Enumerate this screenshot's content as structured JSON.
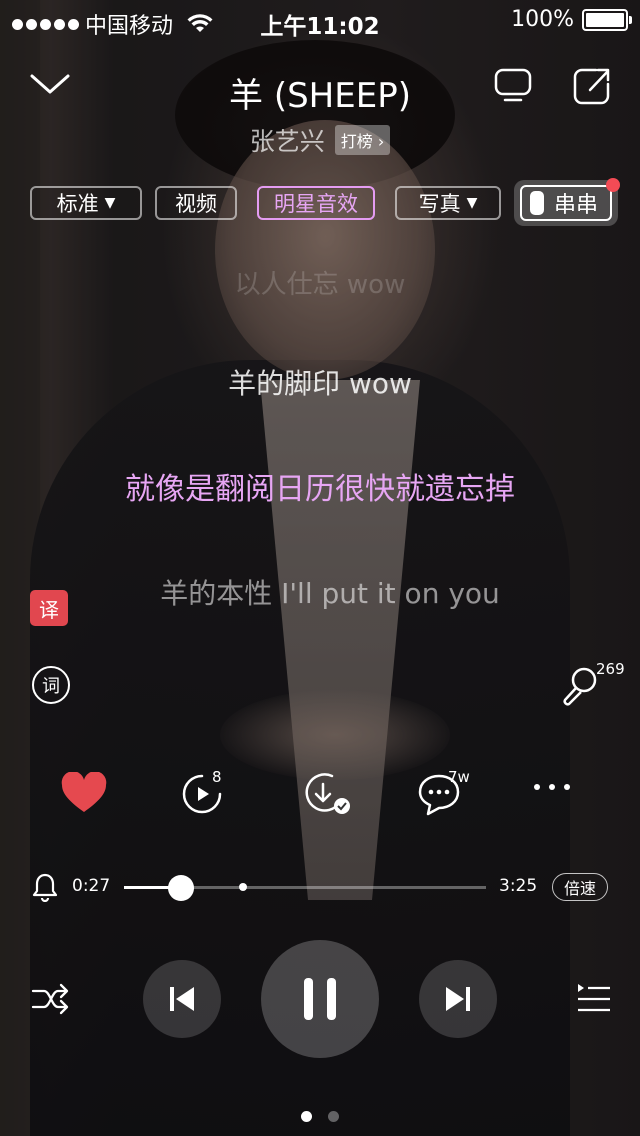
{
  "status_bar": {
    "carrier": "中国移动",
    "time": "上午11:02",
    "battery": "100%"
  },
  "header": {
    "title": "羊 (SHEEP)",
    "artist": "张艺兴",
    "chart_badge": "打榜 ›"
  },
  "options": {
    "quality": "标准",
    "video": "视频",
    "star_effect": "明星音效",
    "photos": "写真",
    "chuanchuan": "串串"
  },
  "lyrics": {
    "faded": "以人仕忘 wow",
    "previous": "羊的脚印 wow",
    "current": "就像是翻阅日历很快就遗忘掉",
    "next": "羊的本性 I'll put it on you"
  },
  "side": {
    "translate_label": "译",
    "lyrics_label": "词",
    "mic_count": "269"
  },
  "actions": {
    "mv_count": "8",
    "comment_count": "7w",
    "liked": true
  },
  "progress": {
    "current": "0:27",
    "total": "3:25",
    "fraction": 0.157,
    "marker_fraction": 0.33,
    "speed_label": "倍速"
  },
  "playback": {
    "state": "playing"
  },
  "pager": {
    "pages": 2,
    "active": 0
  },
  "colors": {
    "accent_purple": "#e7a6f4",
    "heart_red": "#e5494f",
    "badge_red": "#f34b55"
  }
}
